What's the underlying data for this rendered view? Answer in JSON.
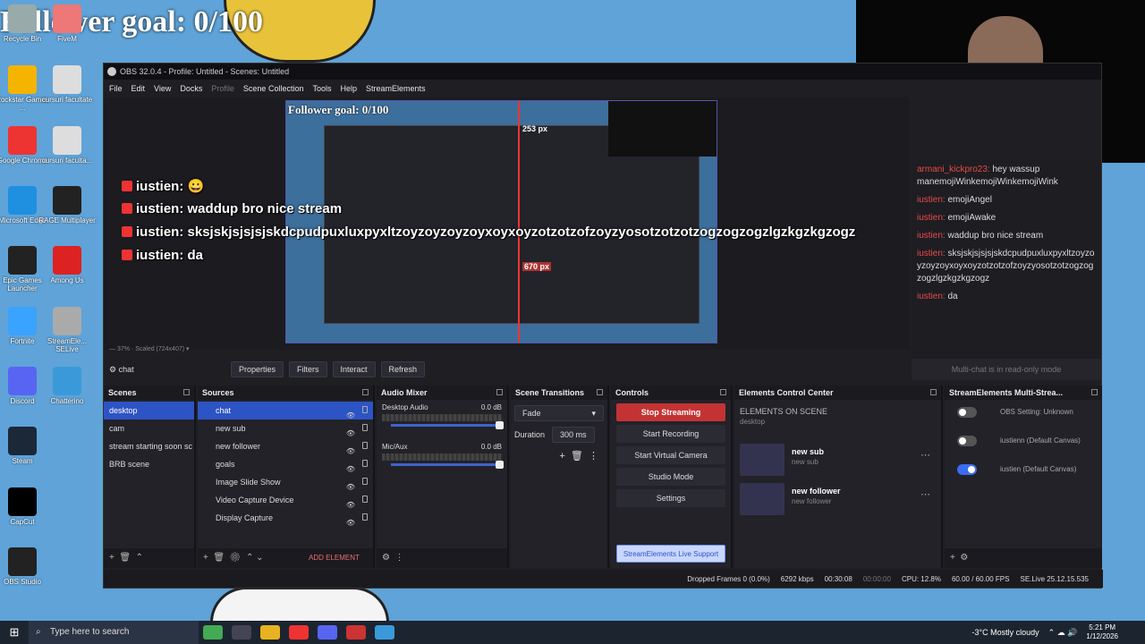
{
  "desktop": {
    "overlay_goal": "Follower goal: 0/100",
    "icons": [
      {
        "label": "Recycle Bin",
        "color": "#9aa"
      },
      {
        "label": "FiveM",
        "color": "#e77"
      },
      {
        "label": "Rockstar Games ...",
        "color": "#f5b400"
      },
      {
        "label": "cursuri facultate",
        "color": "#ddd"
      },
      {
        "label": "Google Chrome",
        "color": "#e33"
      },
      {
        "label": "cursuri faculta...",
        "color": "#ddd"
      },
      {
        "label": "Microsoft Edge",
        "color": "#1f8fe0"
      },
      {
        "label": "RAGE Multiplayer",
        "color": "#222"
      },
      {
        "label": "Epic Games Launcher",
        "color": "#222"
      },
      {
        "label": "Among Us",
        "color": "#d22"
      },
      {
        "label": "Fortnite",
        "color": "#3aa2ff"
      },
      {
        "label": "StreamEle... SELive",
        "color": "#aaa"
      },
      {
        "label": "Discord",
        "color": "#5865f2"
      },
      {
        "label": "Chatterino",
        "color": "#3a9ad9"
      },
      {
        "label": "Steam",
        "color": "#1b2838"
      },
      {
        "label": "CapCut",
        "color": "#000"
      },
      {
        "label": "OBS Studio",
        "color": "#222"
      }
    ]
  },
  "obs": {
    "title": "OBS 32.0.4 - Profile: Untitled - Scenes: Untitled",
    "menu": [
      "File",
      "Edit",
      "View",
      "Docks",
      "Profile",
      "Scene Collection",
      "Tools",
      "Help",
      "StreamElements"
    ],
    "preview": {
      "goal_text": "Follower goal: 0/100",
      "measure_top": "253 px",
      "measure_bottom": "670 px",
      "zoom": "37%",
      "scaled": "Scaled (724x407)"
    },
    "chat_overlay": [
      {
        "user": "iustien:",
        "msg": "😀"
      },
      {
        "user": "iustien:",
        "msg": "waddup bro nice stream"
      },
      {
        "user": "iustien:",
        "msg": "sksjskjsjsjsjskdcpudpuxluxpyxltzoyzoyzoyzoyxoyxoyzotzotzofzoyzyosotzotzotzogzogzogzlgzkgzkgzogz"
      },
      {
        "user": "iustien:",
        "msg": "da"
      }
    ],
    "source_bar": {
      "current": "chat",
      "properties": "Properties",
      "filters": "Filters",
      "interact": "Interact",
      "refresh": "Refresh"
    },
    "multichat": {
      "lines": [
        {
          "user": "armani_kickpro23:",
          "msg": "hey wassup manemojiWinkemojiWinkemojiWink"
        },
        {
          "user": "iustien:",
          "msg": "emojiAngel"
        },
        {
          "user": "iustien:",
          "msg": "emojiAwake"
        },
        {
          "user": "iustien:",
          "msg": "waddup bro nice stream"
        },
        {
          "user": "iustien:",
          "msg": "sksjskjsjsjsjskdcpudpuxluxpyxltzoyzoyzoyzoyxoyxoyzotzotzofzoyzyosotzotzogzogzogzlgzkgzkgzogz"
        },
        {
          "user": "iustien:",
          "msg": "da"
        }
      ],
      "readonly": "Multi-chat is in read-only mode"
    },
    "scenes": {
      "title": "Scenes",
      "items": [
        "desktop",
        "cam",
        "stream starting soon sc",
        "BRB scene"
      ]
    },
    "sources": {
      "title": "Sources",
      "items": [
        "chat",
        "new sub",
        "new follower",
        "goals",
        "Image Slide Show",
        "Video Capture Device",
        "Display Capture"
      ],
      "add_element": "ADD ELEMENT"
    },
    "mixer": {
      "title": "Audio Mixer",
      "channels": [
        {
          "name": "Desktop Audio",
          "db": "0.0 dB"
        },
        {
          "name": "Mic/Aux",
          "db": "0.0 dB"
        }
      ]
    },
    "transitions": {
      "title": "Scene Transitions",
      "selected": "Fade",
      "duration_label": "Duration",
      "duration_value": "300 ms"
    },
    "controls": {
      "title": "Controls",
      "stop_streaming": "Stop Streaming",
      "start_recording": "Start Recording",
      "start_virtual_camera": "Start Virtual Camera",
      "studio_mode": "Studio Mode",
      "settings": "Settings",
      "live_support": "StreamElements Live Support"
    },
    "ecc": {
      "title": "Elements Control Center",
      "heading": "ELEMENTS ON SCENE",
      "scene": "desktop",
      "cards": [
        {
          "title": "new sub",
          "sub": "new sub"
        },
        {
          "title": "new follower",
          "sub": "new follower"
        }
      ]
    },
    "multistream": {
      "title": "StreamElements Multi-Strea...",
      "rows": [
        {
          "label": "OBS Setting: Unknown",
          "on": false
        },
        {
          "label": "iustienn (Default Canvas)",
          "on": false
        },
        {
          "label": "iustien (Default Canvas)",
          "on": true
        }
      ]
    },
    "status": {
      "dropped": "Dropped Frames 0 (0.0%)",
      "bitrate": "6292 kbps",
      "stream_time": "00:30:08",
      "rec_time": "00:00:00",
      "cpu": "CPU: 12.8%",
      "fps": "60.00 / 60.00 FPS",
      "version": "SE.Live 25.12.15.535"
    }
  },
  "taskbar": {
    "search_placeholder": "Type here to search",
    "weather": "-3°C  Mostly cloudy",
    "time": "5:21 PM",
    "date": "1/12/2026"
  }
}
